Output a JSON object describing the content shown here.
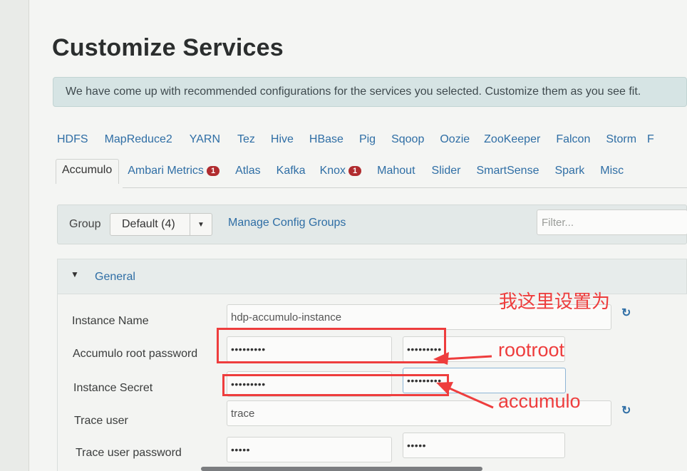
{
  "page": {
    "title": "Customize Services",
    "alert": "We have come up with recommended configurations for the services you selected. Customize them as you see fit."
  },
  "tabs_row1": [
    {
      "label": "HDFS"
    },
    {
      "label": "MapReduce2"
    },
    {
      "label": "YARN"
    },
    {
      "label": "Tez"
    },
    {
      "label": "Hive"
    },
    {
      "label": "HBase"
    },
    {
      "label": "Pig"
    },
    {
      "label": "Sqoop"
    },
    {
      "label": "Oozie"
    },
    {
      "label": "ZooKeeper"
    },
    {
      "label": "Falcon"
    },
    {
      "label": "Storm"
    },
    {
      "label": "F"
    }
  ],
  "tabs_row2": [
    {
      "label": "Accumulo",
      "active": true
    },
    {
      "label": "Ambari Metrics",
      "badge": "1"
    },
    {
      "label": "Atlas"
    },
    {
      "label": "Kafka"
    },
    {
      "label": "Knox",
      "badge": "1"
    },
    {
      "label": "Mahout"
    },
    {
      "label": "Slider"
    },
    {
      "label": "SmartSense"
    },
    {
      "label": "Spark"
    },
    {
      "label": "Misc"
    }
  ],
  "group_bar": {
    "label": "Group",
    "selected": "Default (4)",
    "manage_link": "Manage Config Groups",
    "filter_placeholder": "Filter..."
  },
  "section": {
    "title": "General"
  },
  "fields": {
    "instance_name": {
      "label": "Instance Name",
      "value": "hdp-accumulo-instance"
    },
    "root_password": {
      "label": "Accumulo root password",
      "value": "•••••••••",
      "confirm": "•••••••••"
    },
    "instance_secret": {
      "label": "Instance Secret",
      "value": "•••••••••",
      "confirm": "•••••••••"
    },
    "trace_user": {
      "label": "Trace user",
      "value": "trace"
    },
    "trace_password": {
      "label": "Trace user password",
      "value": "•••••",
      "confirm": "•••••"
    }
  },
  "annotations": {
    "note": "我这里设置为",
    "root_value": "rootroot",
    "secret_value": "accumulo"
  },
  "colors": {
    "link": "#2f6ea5",
    "badge": "#b02c2f",
    "annotation": "#ee3d3d"
  }
}
